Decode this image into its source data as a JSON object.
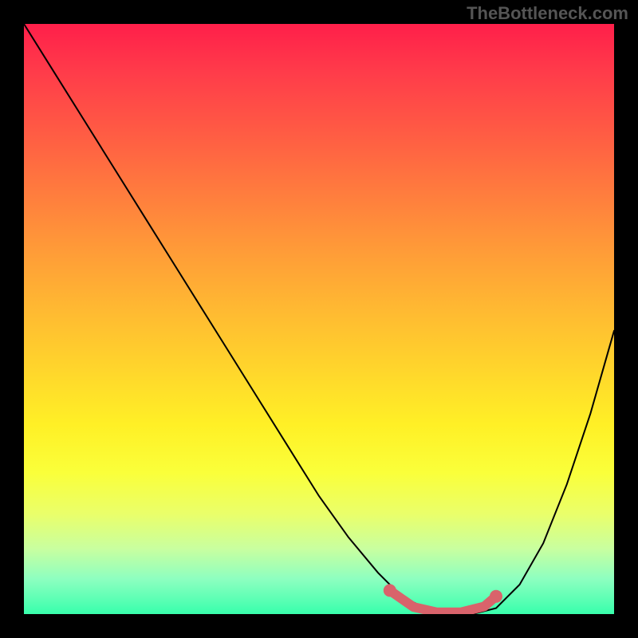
{
  "watermark": "TheBottleneck.com",
  "chart_data": {
    "type": "line",
    "title": "",
    "xlabel": "",
    "ylabel": "",
    "xlim": [
      0,
      100
    ],
    "ylim": [
      0,
      100
    ],
    "series": [
      {
        "name": "bottleneck-curve",
        "x": [
          0,
          5,
          10,
          15,
          20,
          25,
          30,
          35,
          40,
          45,
          50,
          55,
          60,
          64,
          68,
          72,
          76,
          80,
          84,
          88,
          92,
          96,
          100
        ],
        "values": [
          100,
          92,
          84,
          76,
          68,
          60,
          52,
          44,
          36,
          28,
          20,
          13,
          7,
          3,
          1,
          0,
          0,
          1,
          5,
          12,
          22,
          34,
          48
        ]
      }
    ],
    "highlight": {
      "name": "optimal-range",
      "x": [
        62,
        66,
        70,
        74,
        78,
        80
      ],
      "values": [
        4.0,
        1.2,
        0.3,
        0.3,
        1.3,
        3.0
      ],
      "endpoints": [
        {
          "x": 62,
          "y": 4.0
        },
        {
          "x": 80,
          "y": 3.0
        }
      ]
    }
  }
}
